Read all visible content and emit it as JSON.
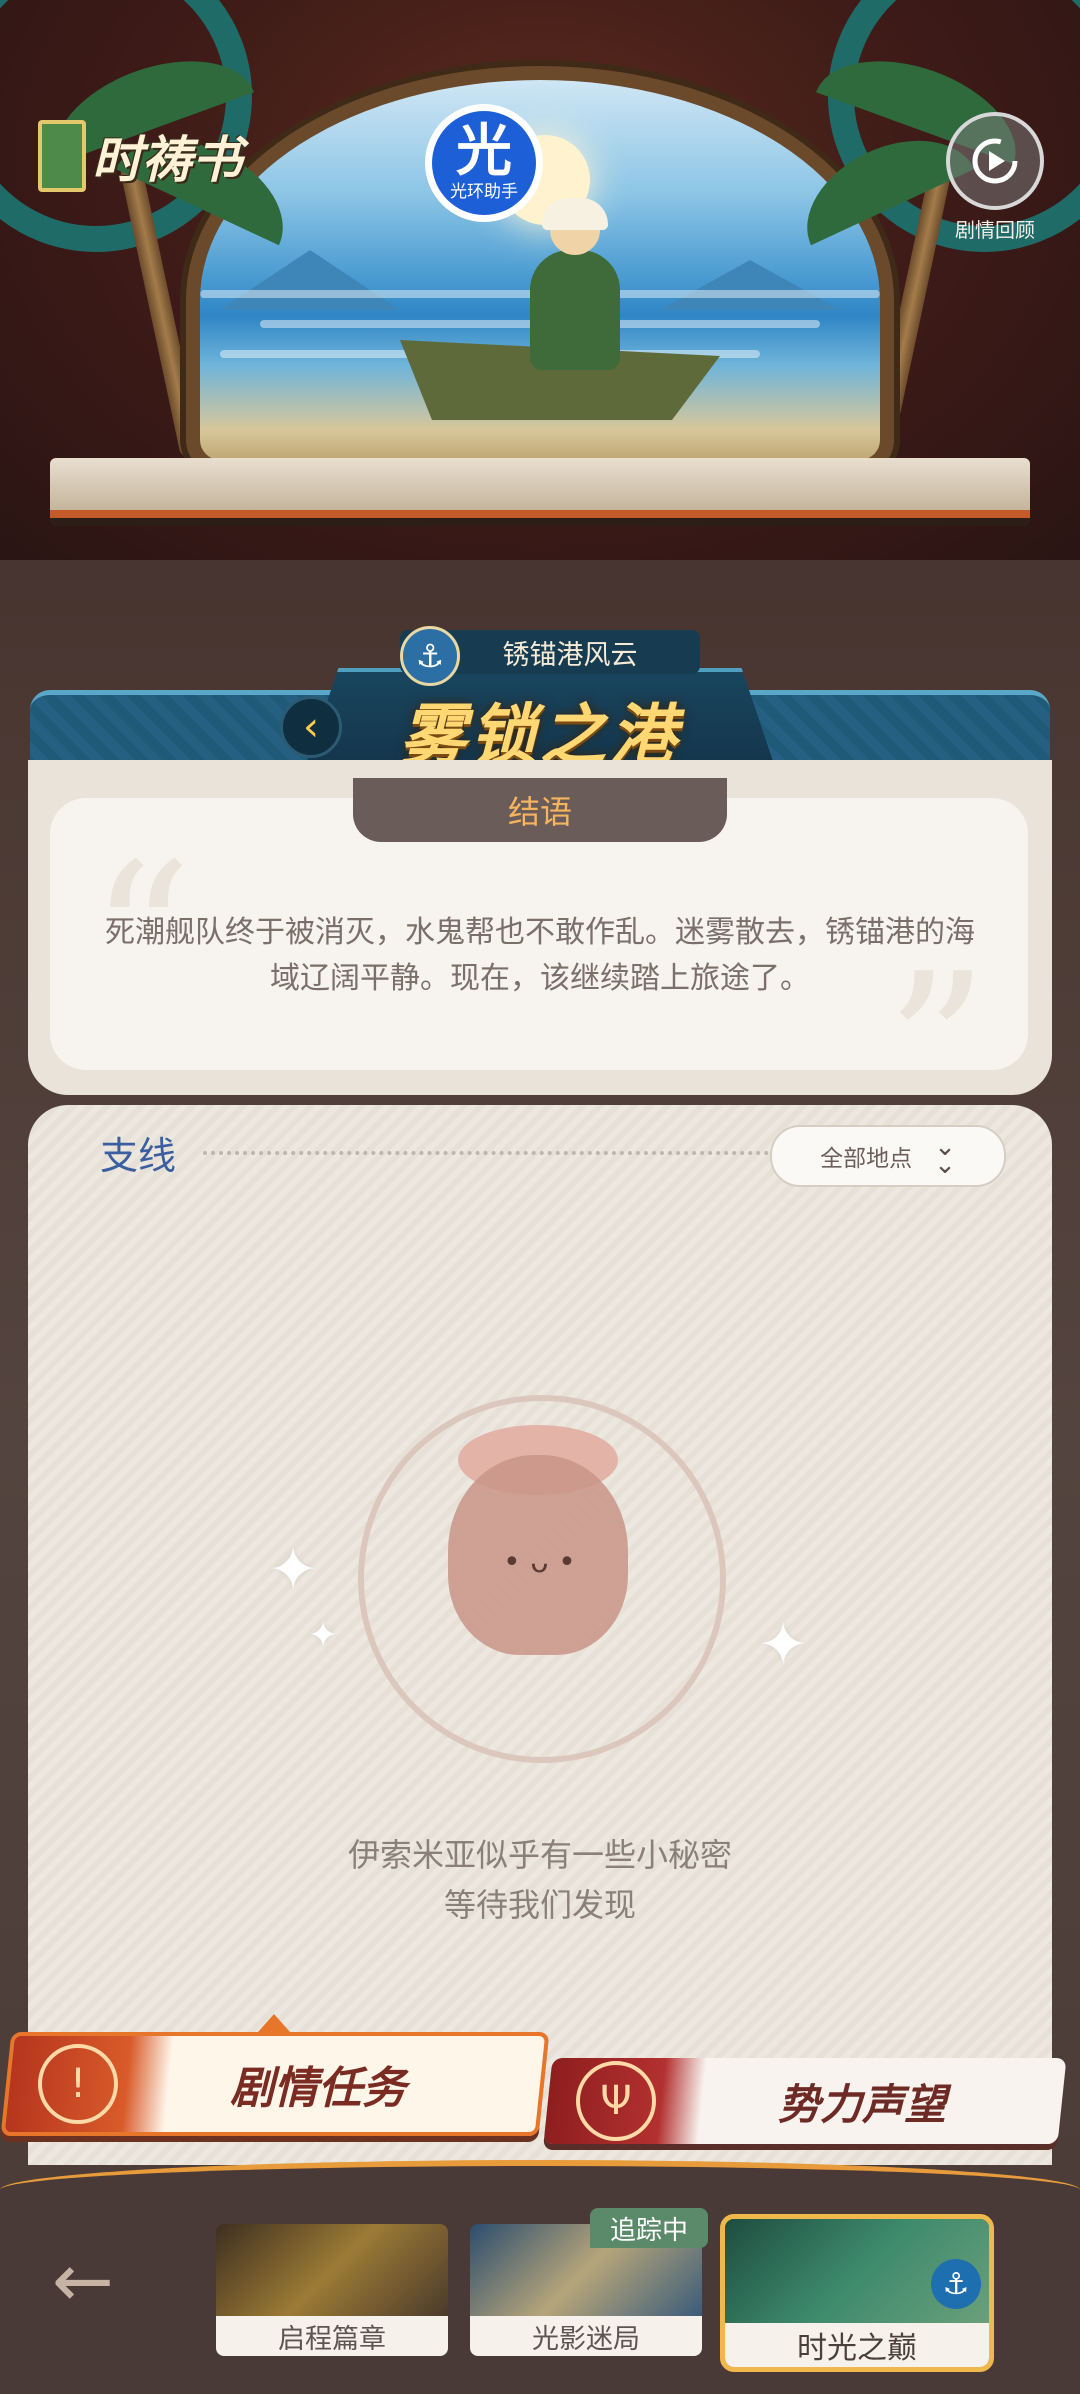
{
  "header": {
    "logo_text": "时祷书",
    "badge_char": "光",
    "badge_sub": "光环助手",
    "replay_icon": "replay-icon",
    "replay_label": "剧情回顾"
  },
  "chapter": {
    "subtitle": "锈锚港风云",
    "title": "雾锁之港",
    "anchor_icon": "⚓",
    "back_icon": "‹"
  },
  "epilogue": {
    "tab_label": "结语",
    "text": "死潮舰队终于被消灭，水鬼帮也不敢作乱。迷雾散去，锈锚港的海域辽阔平静。现在，该继续踏上旅途了。"
  },
  "side_quests": {
    "label": "支线",
    "filter_label": "全部地点",
    "empty_line1": "伊索米亚似乎有一些小秘密",
    "empty_line2": "等待我们发现"
  },
  "missions": {
    "story_label": "剧情任务",
    "reputation_label": "势力声望"
  },
  "nav": {
    "back_icon": "←",
    "chapters": [
      {
        "label": "启程篇章"
      },
      {
        "label": "光影迷局",
        "badge": "追踪中"
      },
      {
        "label": "时光之巅"
      }
    ]
  },
  "colors": {
    "accent_orange": "#e7762b",
    "title_gold": "#ffd873",
    "side_label_blue": "#3a5ea0"
  }
}
